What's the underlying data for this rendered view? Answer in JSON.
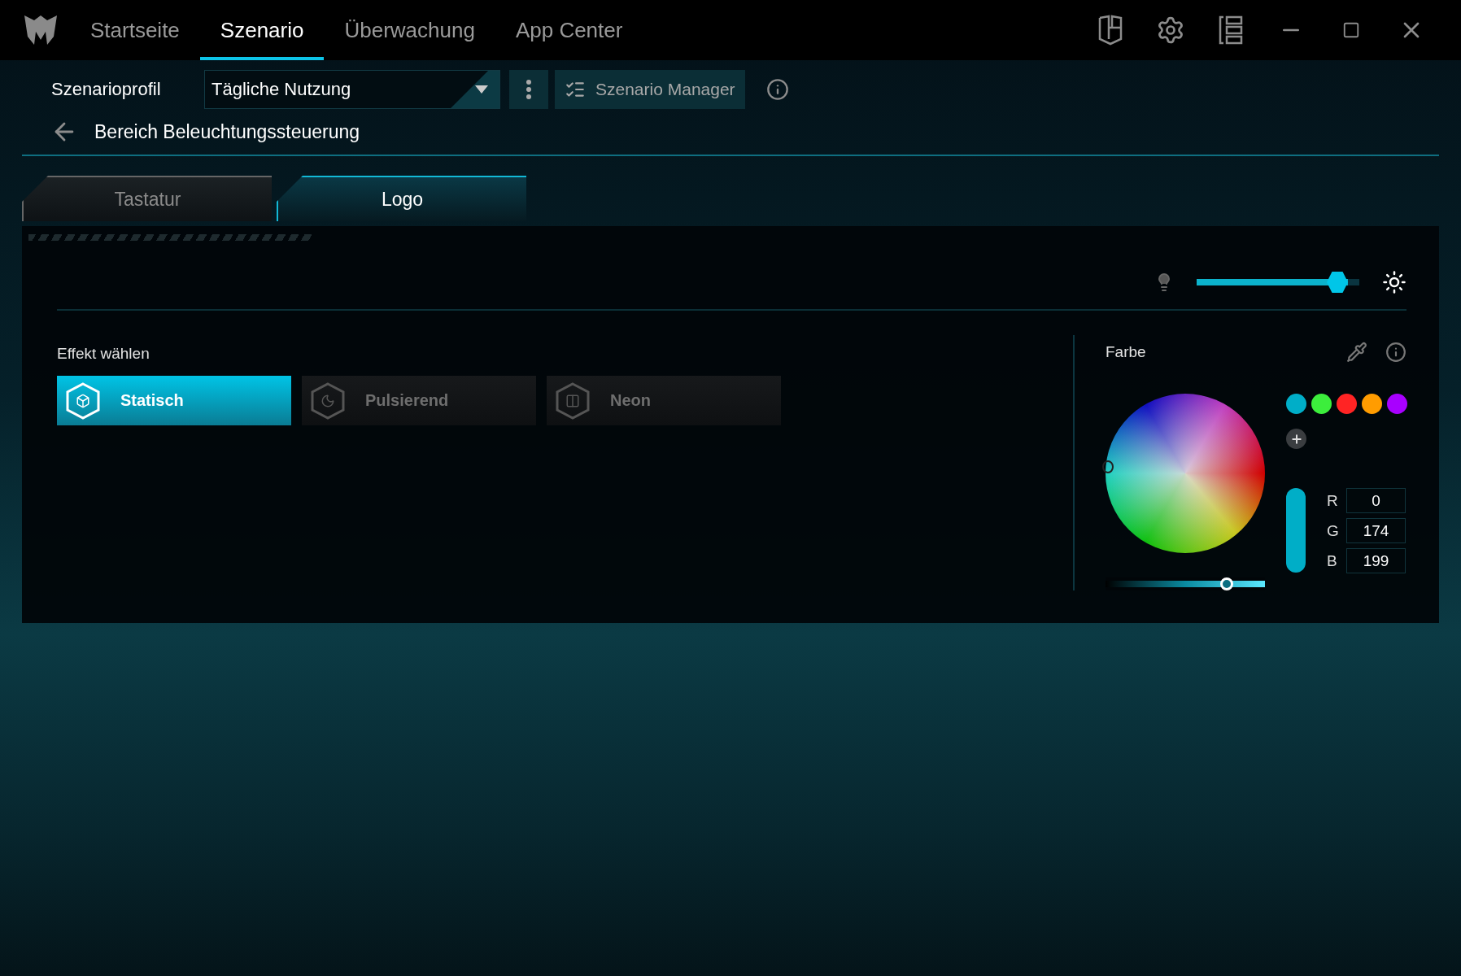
{
  "nav": {
    "tabs": [
      {
        "label": "Startseite",
        "selected": false
      },
      {
        "label": "Szenario",
        "selected": true
      },
      {
        "label": "Überwachung",
        "selected": false
      },
      {
        "label": "App Center",
        "selected": false
      }
    ]
  },
  "profile": {
    "label": "Szenarioprofil",
    "value": "Tägliche Nutzung",
    "manager_button": "Szenario Manager"
  },
  "breadcrumb": "Bereich Beleuchtungssteuerung",
  "zone_tabs": [
    {
      "label": "Tastatur",
      "selected": false
    },
    {
      "label": "Logo",
      "selected": true
    }
  ],
  "brightness": {
    "level": 0.93
  },
  "effects": {
    "title": "Effekt wählen",
    "items": [
      {
        "label": "Statisch",
        "kind": "static",
        "selected": true
      },
      {
        "label": "Pulsierend",
        "kind": "pulse",
        "selected": false
      },
      {
        "label": "Neon",
        "kind": "neon",
        "selected": false
      }
    ]
  },
  "color": {
    "title": "Farbe",
    "swatches": [
      {
        "color": "#00aec8"
      },
      {
        "color": "#3cee3c"
      },
      {
        "color": "#ff2424"
      },
      {
        "color": "#ff9c00"
      },
      {
        "color": "#a800ff"
      }
    ],
    "hue": {
      "level": 0.76
    },
    "channels": [
      {
        "label": "R",
        "value": "0"
      },
      {
        "label": "G",
        "value": "174"
      },
      {
        "label": "B",
        "value": "199"
      }
    ]
  }
}
